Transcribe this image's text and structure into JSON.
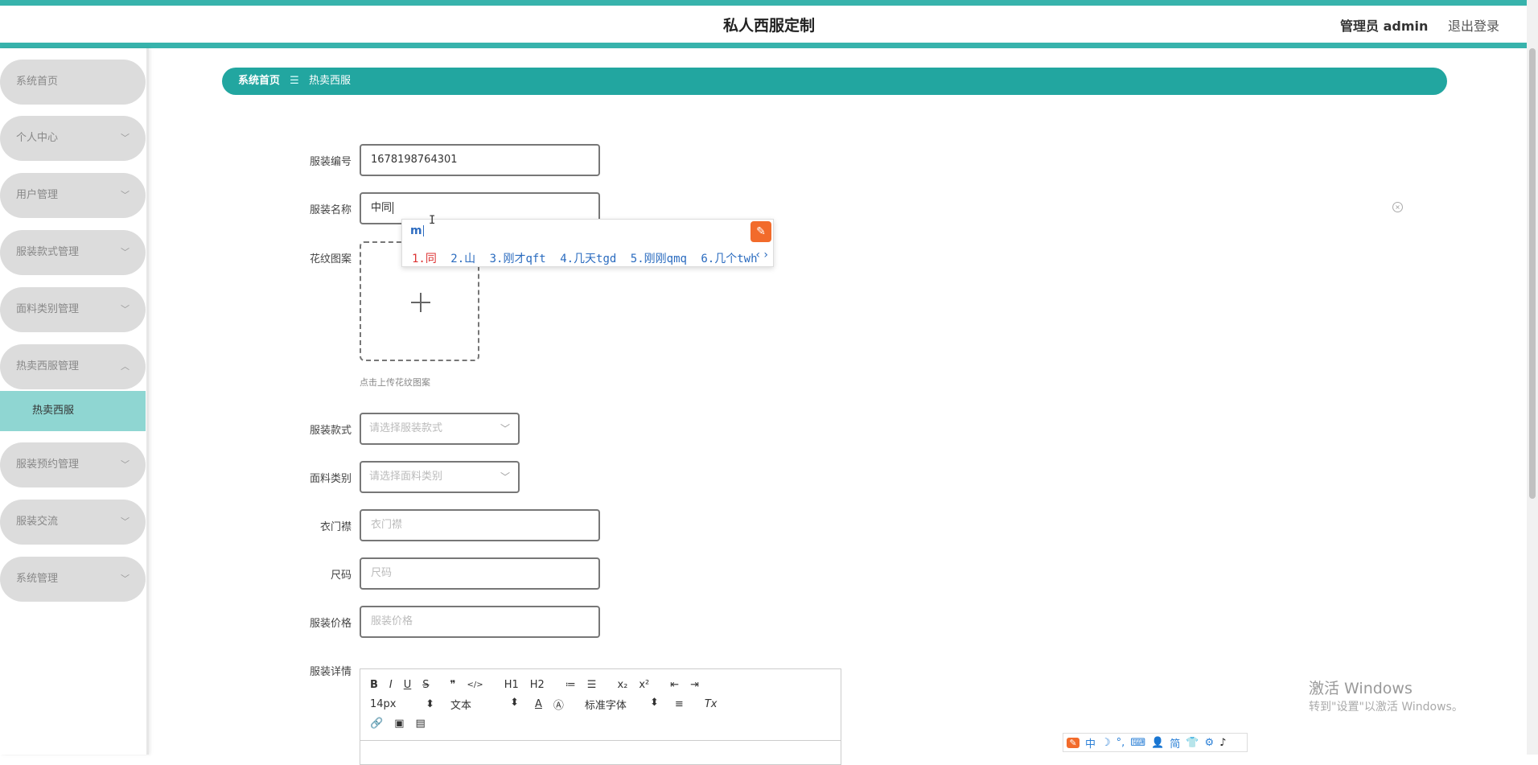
{
  "header": {
    "title": "私人西服定制",
    "admin": "管理员 admin",
    "logout": "退出登录"
  },
  "sidebar": {
    "items": [
      {
        "label": "系统首页",
        "chevron": ""
      },
      {
        "label": "个人中心",
        "chevron": "﹀"
      },
      {
        "label": "用户管理",
        "chevron": "﹀"
      },
      {
        "label": "服装款式管理",
        "chevron": "﹀"
      },
      {
        "label": "面料类别管理",
        "chevron": "﹀"
      },
      {
        "label": "热卖西服管理",
        "chevron": "︿"
      },
      {
        "label": "服装预约管理",
        "chevron": "﹀"
      },
      {
        "label": "服装交流",
        "chevron": "﹀"
      },
      {
        "label": "系统管理",
        "chevron": "﹀"
      }
    ],
    "sub_item": "热卖西服"
  },
  "breadcrumb": {
    "home": "系统首页",
    "separator": "☰",
    "current": "热卖西服"
  },
  "form": {
    "code": {
      "label": "服装编号",
      "value": "1678198764301"
    },
    "name": {
      "label": "服装名称",
      "value": "中同"
    },
    "pattern": {
      "label": "花纹图案",
      "hint": "点击上传花纹图案"
    },
    "style": {
      "label": "服装款式",
      "placeholder": "请选择服装款式"
    },
    "fabric": {
      "label": "面料类别",
      "placeholder": "请选择面料类别"
    },
    "placket": {
      "label": "衣门襟",
      "placeholder": "衣门襟"
    },
    "size": {
      "label": "尺码",
      "placeholder": "尺码"
    },
    "price": {
      "label": "服装价格",
      "placeholder": "服装价格"
    },
    "details": {
      "label": "服装详情"
    }
  },
  "ime": {
    "input": "m",
    "candidates": [
      "1.同",
      "2.山",
      "3.刚才qft",
      "4.几天tgd",
      "5.刚刚qmq",
      "6.几个twh"
    ],
    "nav": "‹ ›"
  },
  "editor_toolbar": {
    "row1": [
      "B",
      "I",
      "U",
      "S",
      "❞",
      "</>",
      "H1",
      "H2",
      "≔",
      "☰",
      "x₂",
      "x²",
      "⇤",
      "⇥"
    ],
    "font_size": "14px",
    "text_type": "文本",
    "font_family": "标准字体",
    "row2_icons": [
      "A",
      "Ⓐ",
      "≡",
      "Tx"
    ],
    "row3": [
      "🔗",
      "▣",
      "▤"
    ]
  },
  "watermark": {
    "line1": "激活 Windows",
    "line2": "转到\"设置\"以激活 Windows。"
  },
  "tray": [
    "中",
    "☽",
    "°,",
    "⌨",
    "👤",
    "简",
    "👕",
    "⚙",
    "♪"
  ]
}
